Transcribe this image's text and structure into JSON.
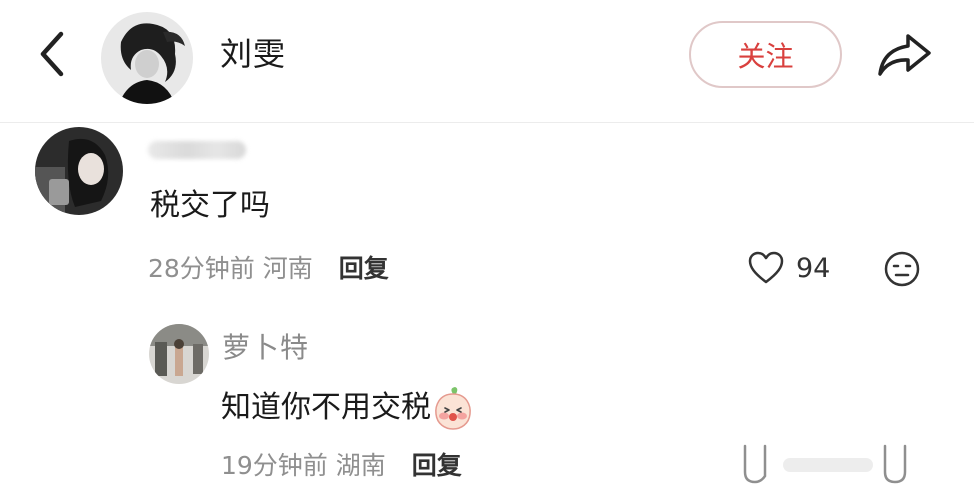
{
  "header": {
    "back_icon": "chevron-left-icon",
    "username": "刘雯",
    "follow_label": "关注",
    "share_icon": "share-arrow-icon",
    "accent_color": "#d9403e"
  },
  "comment": {
    "text": "税交了吗",
    "time": "28分钟前",
    "location": "河南",
    "reply_label": "回复",
    "like_count": "94",
    "like_icon": "heart-outline-icon",
    "emoji_icon": "emoji-face-icon"
  },
  "reply": {
    "username": "萝卜特",
    "text": "知道你不用交税",
    "sticker_icon": "peach-blush-sticker-icon",
    "time": "19分钟前",
    "location": "湖南",
    "reply_label": "回复"
  }
}
